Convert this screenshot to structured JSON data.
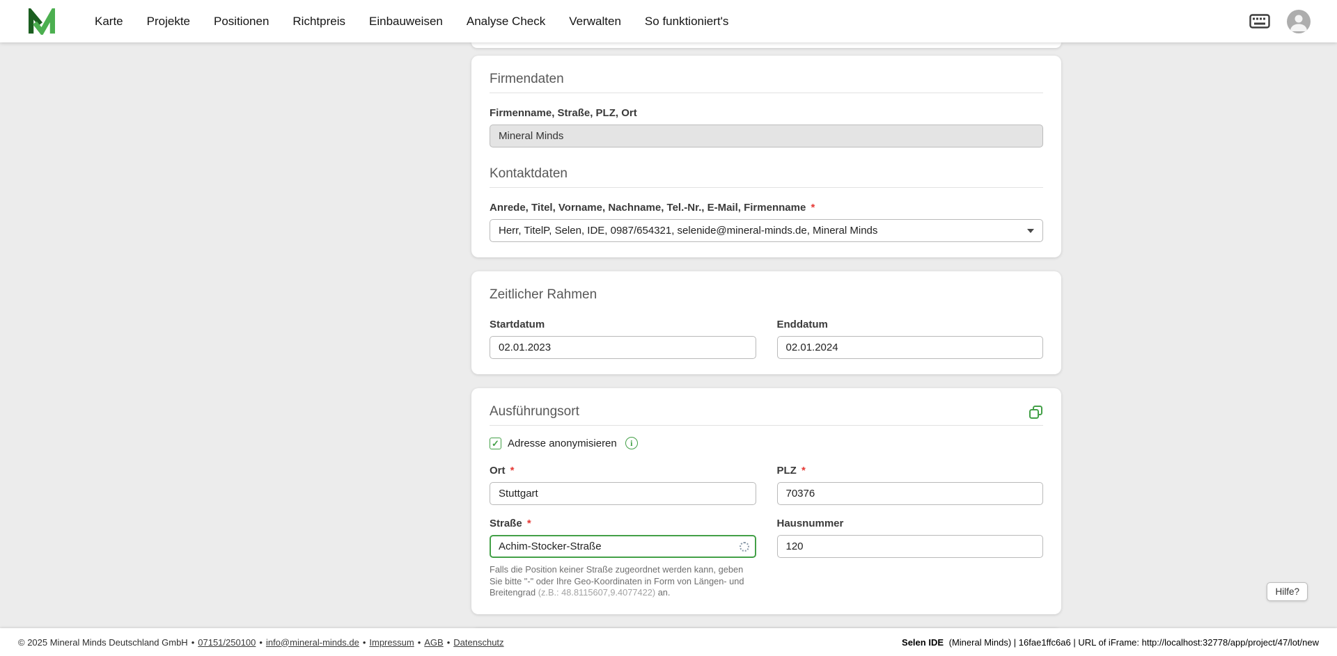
{
  "navbar": {
    "items": [
      {
        "label": "Karte"
      },
      {
        "label": "Projekte"
      },
      {
        "label": "Positionen"
      },
      {
        "label": "Richtpreis"
      },
      {
        "label": "Einbauweisen"
      },
      {
        "label": "Analyse Check"
      },
      {
        "label": "Verwalten"
      },
      {
        "label": "So funktioniert's"
      }
    ]
  },
  "form": {
    "required_mark": "*"
  },
  "cards": {
    "firmendaten": {
      "title": "Firmendaten",
      "company_label": "Firmenname, Straße, PLZ, Ort",
      "company_value": "Mineral Minds",
      "kontakt_title": "Kontaktdaten",
      "kontakt_label": "Anrede, Titel, Vorname, Nachname, Tel.-Nr., E-Mail, Firmenname",
      "kontakt_value": "Herr, TitelP, Selen, IDE, 0987/654321, selenide@mineral-minds.de, Mineral Minds"
    },
    "zeitraum": {
      "title": "Zeitlicher Rahmen",
      "start_label": "Startdatum",
      "start_value": "02.01.2023",
      "end_label": "Enddatum",
      "end_value": "02.01.2024"
    },
    "ausfuehrungsort": {
      "title": "Ausführungsort",
      "anonymize_label": "Adresse anonymisieren",
      "anonymize_checked": true,
      "ort_label": "Ort",
      "ort_value": "Stuttgart",
      "plz_label": "PLZ",
      "plz_value": "70376",
      "strasse_label": "Straße",
      "strasse_value": "Achim-Stocker-Straße",
      "hausnummer_label": "Hausnummer",
      "hausnummer_value": "120",
      "helper_main": "Falls die Position keiner Straße zugeordnet werden kann, geben Sie bitte \"-\" oder Ihre Geo-Koordinaten in Form von Längen- und Breitengrad",
      "helper_coords": "(z.B.: 48.8115607,9.4077422)",
      "helper_suffix": "an."
    }
  },
  "help_button": {
    "label": "Hilfe?"
  },
  "footer": {
    "copyright": "© 2025 Mineral Minds Deutschland GmbH",
    "separator": "•",
    "phone": "07151/250100",
    "email": "info@mineral-minds.de",
    "impressum": "Impressum",
    "agb": "AGB",
    "datenschutz": "Datenschutz",
    "right_app": "Selen IDE",
    "right_info": "(Mineral Minds) | 16fae1ffc6a6 | URL of iFrame: http://localhost:32778/app/project/47/lot/new"
  },
  "colors": {
    "accent_green": "#43a047",
    "required_red": "#e53935",
    "page_bg": "#ececec"
  }
}
